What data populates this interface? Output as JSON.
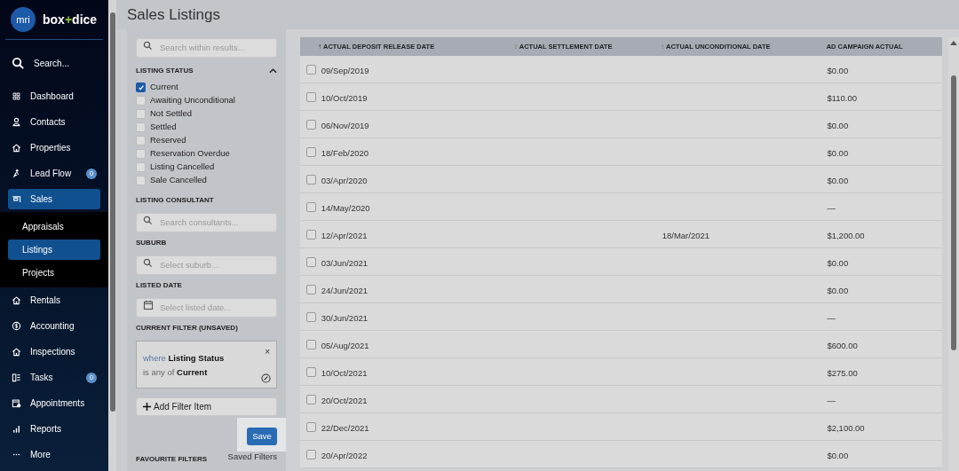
{
  "brand": {
    "logo": "mri",
    "name_left": "box",
    "plus": "+",
    "name_right": "dice"
  },
  "sidebar": {
    "items": [
      {
        "label": "Search...",
        "kind": "search",
        "selected": false
      },
      {
        "label": "Dashboard",
        "kind": "main",
        "selected": false
      },
      {
        "label": "Contacts",
        "kind": "main",
        "selected": false
      },
      {
        "label": "Properties",
        "kind": "main",
        "selected": false
      },
      {
        "label": "Lead Flow",
        "kind": "main",
        "selected": false,
        "badge": "0"
      },
      {
        "label": "Sales",
        "kind": "main",
        "selected": true
      },
      {
        "label": "Appraisals",
        "kind": "sub",
        "selected": false
      },
      {
        "label": "Listings",
        "kind": "sub",
        "selected": true
      },
      {
        "label": "Projects",
        "kind": "sub",
        "selected": false
      },
      {
        "label": "Rentals",
        "kind": "main",
        "selected": false
      },
      {
        "label": "Accounting",
        "kind": "main",
        "selected": false
      },
      {
        "label": "Inspections",
        "kind": "main",
        "selected": false
      },
      {
        "label": "Tasks",
        "kind": "main",
        "selected": false,
        "badge": "0"
      },
      {
        "label": "Appointments",
        "kind": "main",
        "selected": false
      },
      {
        "label": "Reports",
        "kind": "main",
        "selected": false
      },
      {
        "label": "More",
        "kind": "main",
        "selected": false
      }
    ]
  },
  "page_title": "Sales Listings",
  "filters": {
    "search": {
      "placeholder": "Search within results..."
    },
    "listing_status": {
      "title": "LISTING STATUS",
      "expanded": true,
      "options": [
        {
          "label": "Current",
          "checked": true
        },
        {
          "label": "Awaiting Unconditional",
          "checked": false
        },
        {
          "label": "Not Settled",
          "checked": false
        },
        {
          "label": "Settled",
          "checked": false
        },
        {
          "label": "Reserved",
          "checked": false
        },
        {
          "label": "Reservation Overdue",
          "checked": false
        },
        {
          "label": "Listing Cancelled",
          "checked": false
        },
        {
          "label": "Sale Cancelled",
          "checked": false
        }
      ]
    },
    "fields": [
      {
        "title": "LISTING CONSULTANT",
        "placeholder": "Search consultants...",
        "kind": "search"
      },
      {
        "title": "SUBURB",
        "placeholder": "Select suburb...",
        "kind": "search"
      },
      {
        "title": "LISTED DATE",
        "placeholder": "Select listed date...",
        "kind": "date"
      }
    ],
    "current_filter": {
      "title": "CURRENT FILTER (UNSAVED)",
      "where": "where",
      "field": "Listing Status",
      "operator": "is any of",
      "value": "Current",
      "close": "×"
    },
    "add_button": "Add Filter Item",
    "save_button": "Save",
    "favourites_title": "FAVOURITE FILTERS",
    "saved_filters_link": "Saved Filters"
  },
  "table": {
    "columns": [
      {
        "label": "ACTUAL DEPOSIT RELEASE DATE",
        "sort_icon": "↑"
      },
      {
        "label": "ACTUAL SETTLEMENT DATE",
        "sort_icon": "↕"
      },
      {
        "label": "ACTUAL UNCONDITIONAL DATE",
        "sort_icon": "↕"
      },
      {
        "label": "AD CAMPAIGN ACTUAL"
      }
    ],
    "rows": [
      {
        "checked": false,
        "cells": [
          "09/Sep/2019",
          "",
          "",
          "$0.00"
        ]
      },
      {
        "checked": false,
        "cells": [
          "10/Oct/2019",
          "",
          "",
          "$110.00"
        ]
      },
      {
        "checked": false,
        "cells": [
          "06/Nov/2019",
          "",
          "",
          "$0.00"
        ]
      },
      {
        "checked": false,
        "cells": [
          "18/Feb/2020",
          "",
          "",
          "$0.00"
        ]
      },
      {
        "checked": false,
        "cells": [
          "03/Apr/2020",
          "",
          "",
          "$0.00"
        ]
      },
      {
        "checked": false,
        "cells": [
          "14/May/2020",
          "",
          "",
          "—"
        ]
      },
      {
        "checked": false,
        "cells": [
          "12/Apr/2021",
          "",
          "18/Mar/2021",
          "$1,200.00"
        ]
      },
      {
        "checked": false,
        "cells": [
          "03/Jun/2021",
          "",
          "",
          "$0.00"
        ]
      },
      {
        "checked": false,
        "cells": [
          "24/Jun/2021",
          "",
          "",
          "$0.00"
        ]
      },
      {
        "checked": false,
        "cells": [
          "30/Jun/2021",
          "",
          "",
          "—"
        ]
      },
      {
        "checked": false,
        "cells": [
          "05/Aug/2021",
          "",
          "",
          "$600.00"
        ]
      },
      {
        "checked": false,
        "cells": [
          "10/Oct/2021",
          "",
          "",
          "$275.00"
        ]
      },
      {
        "checked": false,
        "cells": [
          "20/Oct/2021",
          "",
          "",
          "—"
        ]
      },
      {
        "checked": false,
        "cells": [
          "22/Dec/2021",
          "",
          "",
          "$2,100.00"
        ]
      },
      {
        "checked": false,
        "cells": [
          "20/Apr/2022",
          "",
          "",
          "$0.00"
        ]
      }
    ]
  }
}
